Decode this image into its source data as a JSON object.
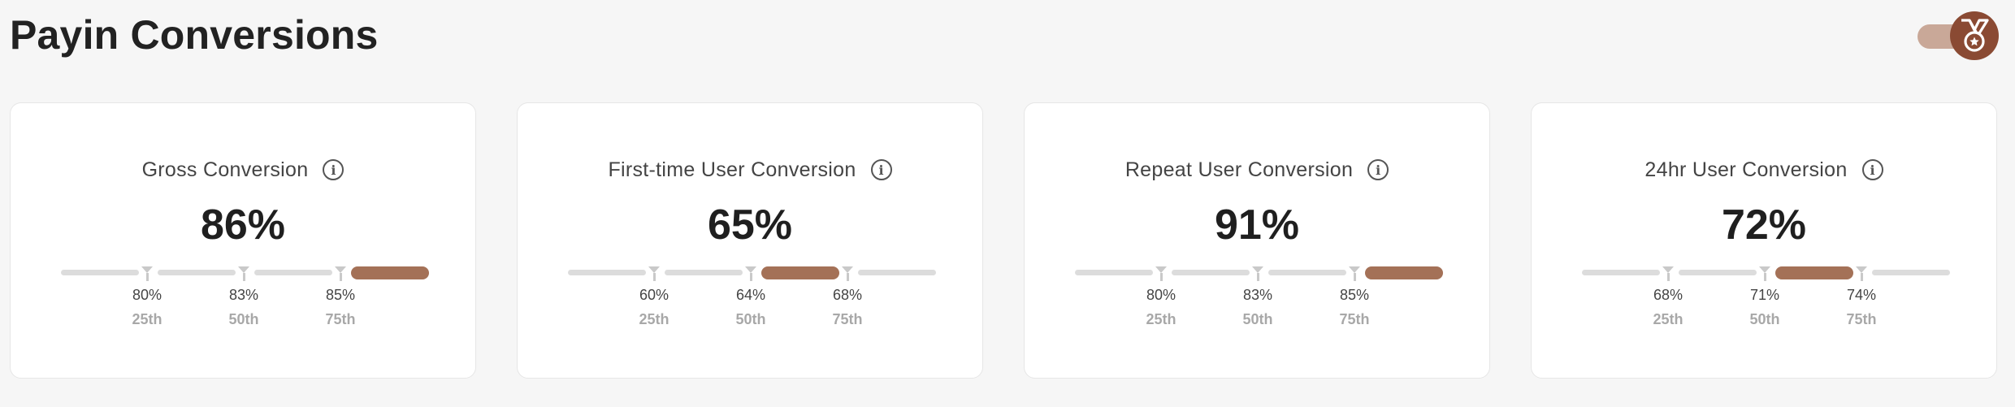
{
  "page": {
    "title": "Payin Conversions"
  },
  "colors": {
    "accent": "#a47157",
    "inactive": "#dcdcdc",
    "marker": "#c9c9c9",
    "avatar": "#8a4a33"
  },
  "header": {
    "toggle": {
      "state": "on",
      "icon": "medal-icon"
    }
  },
  "cards": [
    {
      "label": "Gross Conversion",
      "value": "86%",
      "active_segment": 4,
      "ticks": [
        {
          "value": "80%",
          "label": "25th"
        },
        {
          "value": "83%",
          "label": "50th"
        },
        {
          "value": "85%",
          "label": "75th"
        }
      ]
    },
    {
      "label": "First-time User Conversion",
      "value": "65%",
      "active_segment": 3,
      "ticks": [
        {
          "value": "60%",
          "label": "25th"
        },
        {
          "value": "64%",
          "label": "50th"
        },
        {
          "value": "68%",
          "label": "75th"
        }
      ]
    },
    {
      "label": "Repeat User Conversion",
      "value": "91%",
      "active_segment": 4,
      "ticks": [
        {
          "value": "80%",
          "label": "25th"
        },
        {
          "value": "83%",
          "label": "50th"
        },
        {
          "value": "85%",
          "label": "75th"
        }
      ]
    },
    {
      "label": "24hr User Conversion",
      "value": "72%",
      "active_segment": 3,
      "ticks": [
        {
          "value": "68%",
          "label": "25th"
        },
        {
          "value": "71%",
          "label": "50th"
        },
        {
          "value": "74%",
          "label": "75th"
        }
      ]
    }
  ]
}
